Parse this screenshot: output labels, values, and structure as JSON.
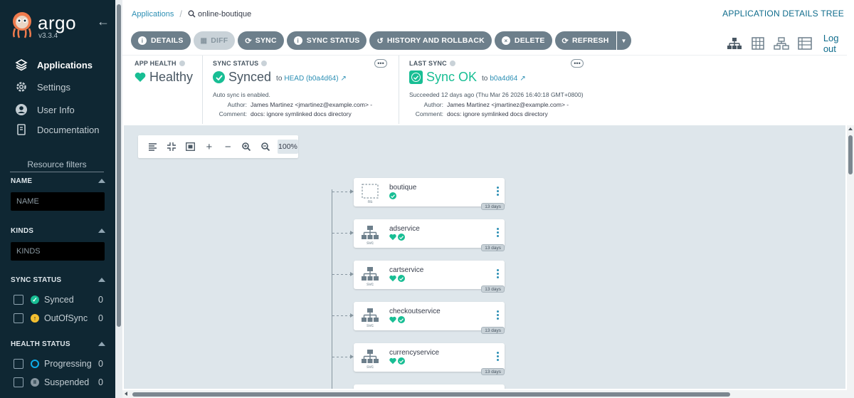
{
  "brand": {
    "name": "argo",
    "version": "v3.3.4"
  },
  "nav": [
    {
      "label": "Applications",
      "icon": "layers-icon",
      "active": true
    },
    {
      "label": "Settings",
      "icon": "gear-icon",
      "active": false
    },
    {
      "label": "User Info",
      "icon": "user-icon",
      "active": false
    },
    {
      "label": "Documentation",
      "icon": "book-icon",
      "active": false
    }
  ],
  "filters": {
    "heading": "Resource filters",
    "name": {
      "title": "NAME",
      "placeholder": "NAME"
    },
    "kinds": {
      "title": "KINDS",
      "placeholder": "KINDS"
    },
    "sync_status": {
      "title": "SYNC STATUS",
      "items": [
        {
          "label": "Synced",
          "count": "0",
          "color": "#18be94"
        },
        {
          "label": "OutOfSync",
          "count": "0",
          "color": "#f4c030"
        }
      ]
    },
    "health_status": {
      "title": "HEALTH STATUS",
      "items": [
        {
          "label": "Progressing",
          "count": "0",
          "color": "#0dadea"
        },
        {
          "label": "Suspended",
          "count": "0",
          "color": "#8796a0"
        }
      ]
    }
  },
  "breadcrumb": {
    "root": "Applications",
    "current": "online-boutique"
  },
  "page_title": "APPLICATION DETAILS TREE",
  "toolbar": {
    "details": "DETAILS",
    "diff": "DIFF",
    "sync": "SYNC",
    "sync_status": "SYNC STATUS",
    "history": "HISTORY AND ROLLBACK",
    "delete": "DELETE",
    "refresh": "REFRESH"
  },
  "logout": "Log out",
  "app_health": {
    "title": "APP HEALTH",
    "value": "Healthy"
  },
  "sync_status": {
    "title": "SYNC STATUS",
    "value": "Synced",
    "to_label": "to",
    "revision": "HEAD (b0a4d64)",
    "auto_sync": "Auto sync is enabled.",
    "author_label": "Author:",
    "author": "James Martinez <jmartinez@example.com> -",
    "comment_label": "Comment:",
    "comment": "docs: ignore symlinked docs directory"
  },
  "last_sync": {
    "title": "LAST SYNC",
    "value": "Sync OK",
    "to_label": "to",
    "revision": "b0a4d64",
    "succeeded": "Succeeded 12 days ago (Thu Mar 26 2026 16:40:18 GMT+0800)",
    "author_label": "Author:",
    "author": "James Martinez <jmartinez@example.com> -",
    "comment_label": "Comment:",
    "comment": "docs: ignore symlinked docs directory"
  },
  "zoom": "100%",
  "nodes": [
    {
      "name": "boutique",
      "kind": "ns",
      "age": "13 days",
      "healthy": false
    },
    {
      "name": "adservice",
      "kind": "svc",
      "age": "13 days",
      "healthy": true
    },
    {
      "name": "cartservice",
      "kind": "svc",
      "age": "13 days",
      "healthy": true
    },
    {
      "name": "checkoutservice",
      "kind": "svc",
      "age": "13 days",
      "healthy": true
    },
    {
      "name": "currencyservice",
      "kind": "svc",
      "age": "13 days",
      "healthy": true
    }
  ],
  "colors": {
    "sidebar": "#0f2733",
    "accent": "#18be94",
    "link": "#2c8fb4",
    "button": "#6d7f8b",
    "canvas": "#dee6eb"
  }
}
